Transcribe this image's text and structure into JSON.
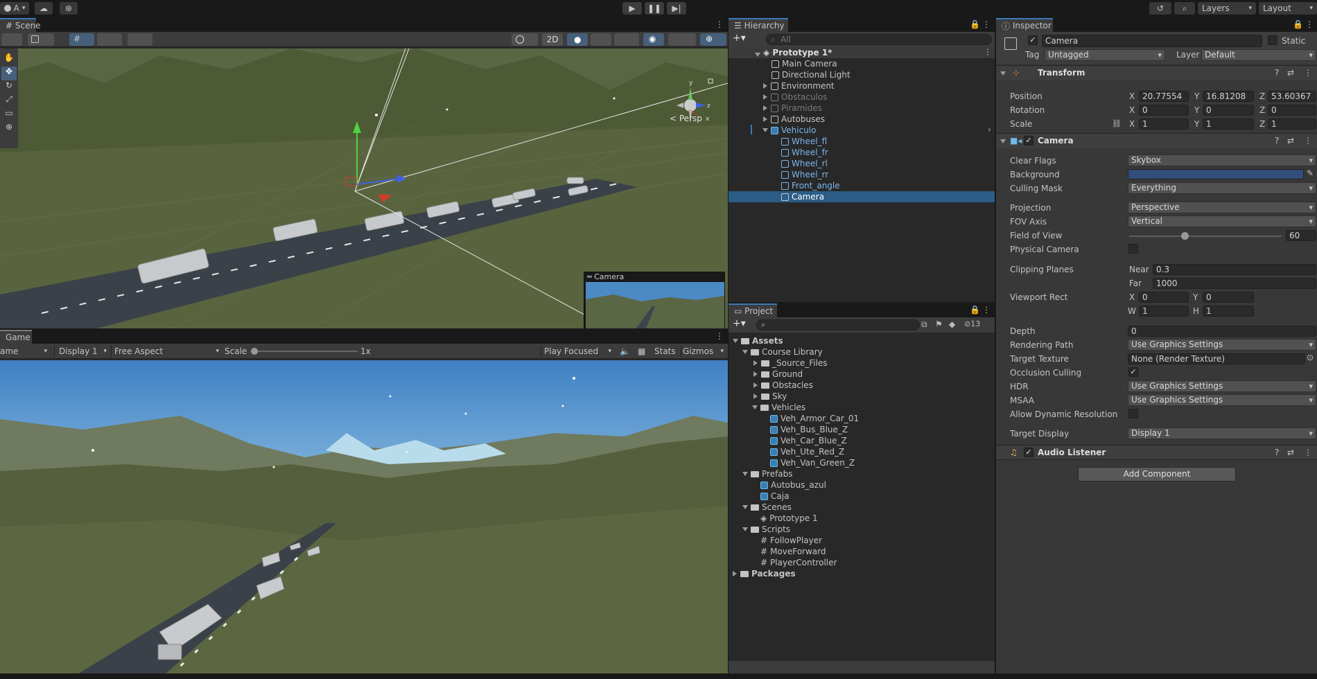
{
  "toolbar": {
    "account_label": "A",
    "layers_label": "Layers",
    "layout_label": "Layout"
  },
  "scene": {
    "tab_label": "Scene",
    "btn_2d": "2D",
    "persp_label": "Persp",
    "camera_preview_title": "Camera"
  },
  "game": {
    "tab_label": "Game",
    "mode_label": "ame",
    "display": "Display 1",
    "aspect": "Free Aspect",
    "scale_label": "Scale",
    "scale_value": "1x",
    "play_mode": "Play Focused",
    "stats_label": "Stats",
    "gizmos_label": "Gizmos"
  },
  "hierarchy": {
    "tab_label": "Hierarchy",
    "search_placeholder": "All",
    "scene_name": "Prototype 1*",
    "items": [
      "Main Camera",
      "Directional Light",
      "Environment",
      "Obstaculos",
      "Piramides",
      "Autobuses",
      "Vehiculo",
      "Wheel_fl",
      "Wheel_fr",
      "Wheel_rl",
      "Wheel_rr",
      "Front_angle",
      "Camera"
    ]
  },
  "project": {
    "tab_label": "Project",
    "count": "13",
    "tree": [
      "Assets",
      "Course Library",
      "_Source_Files",
      "Ground",
      "Obstacles",
      "Sky",
      "Vehicles",
      "Veh_Armor_Car_01",
      "Veh_Bus_Blue_Z",
      "Veh_Car_Blue_Z",
      "Veh_Ute_Red_Z",
      "Veh_Van_Green_Z",
      "Prefabs",
      "Autobus_azul",
      "Caja",
      "Scenes",
      "Prototype 1",
      "Scripts",
      "FollowPlayer",
      "MoveForward",
      "PlayerController",
      "Packages"
    ]
  },
  "inspector": {
    "tab_label": "Inspector",
    "object_name": "Camera",
    "static_label": "Static",
    "tag_label": "Tag",
    "tag_value": "Untagged",
    "layer_label": "Layer",
    "layer_value": "Default",
    "transform": {
      "title": "Transform",
      "position_label": "Position",
      "rotation_label": "Rotation",
      "scale_label": "Scale",
      "axis_x": "X",
      "axis_y": "Y",
      "axis_z": "Z",
      "pos_x": "20.77554",
      "pos_y": "16.81208",
      "pos_z": "53.60367",
      "rot_x": "0",
      "rot_y": "0",
      "rot_z": "0",
      "scl_x": "1",
      "scl_y": "1",
      "scl_z": "1"
    },
    "camera": {
      "title": "Camera",
      "clear_flags_label": "Clear Flags",
      "clear_flags": "Skybox",
      "background_label": "Background",
      "background_color": "#314d79",
      "culling_mask_label": "Culling Mask",
      "culling_mask": "Everything",
      "projection_label": "Projection",
      "projection": "Perspective",
      "fov_axis_label": "FOV Axis",
      "fov_axis": "Vertical",
      "fov_label": "Field of View",
      "fov": "60",
      "fov_fraction": 0.34,
      "physical_label": "Physical Camera",
      "clipping_label": "Clipping Planes",
      "near_label": "Near",
      "near": "0.3",
      "far_label": "Far",
      "far": "1000",
      "viewport_label": "Viewport Rect",
      "vp_x_label": "X",
      "vp_x": "0",
      "vp_y_label": "Y",
      "vp_y": "0",
      "vp_w_label": "W",
      "vp_w": "1",
      "vp_h_label": "H",
      "vp_h": "1",
      "depth_label": "Depth",
      "depth": "0",
      "rendering_path_label": "Rendering Path",
      "rendering_path": "Use Graphics Settings",
      "target_texture_label": "Target Texture",
      "target_texture": "None (Render Texture)",
      "occlusion_label": "Occlusion Culling",
      "hdr_label": "HDR",
      "hdr": "Use Graphics Settings",
      "msaa_label": "MSAA",
      "msaa": "Use Graphics Settings",
      "dynres_label": "Allow Dynamic Resolution",
      "target_display_label": "Target Display",
      "target_display": "Display 1"
    },
    "audio_listener": {
      "title": "Audio Listener"
    },
    "add_component": "Add Component"
  },
  "colors": {
    "accent": "#3a79bb",
    "selection": "#2c5d87",
    "sky": "#4b8ac5",
    "terrain": "#55603f"
  }
}
